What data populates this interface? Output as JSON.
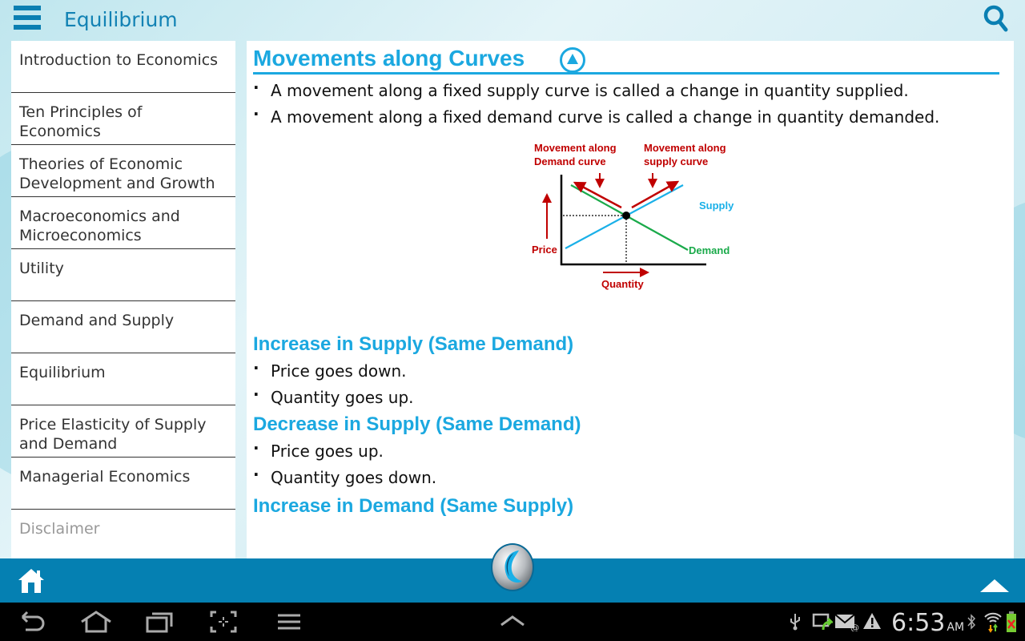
{
  "app": {
    "title": "Equilibrium",
    "menu_icon": "hamburger-menu-icon",
    "search_icon": "search-icon"
  },
  "sidebar": {
    "items": [
      {
        "label": "Introduction to Economics"
      },
      {
        "label": "Ten Principles of Economics"
      },
      {
        "label": "Theories of Economic Development and Growth"
      },
      {
        "label": "Macroeconomics and Microeconomics"
      },
      {
        "label": "Utility"
      },
      {
        "label": "Demand and Supply"
      },
      {
        "label": "Equilibrium"
      },
      {
        "label": "Price Elasticity of Supply and Demand"
      },
      {
        "label": "Managerial Economics"
      },
      {
        "label": "Disclaimer"
      }
    ]
  },
  "content": {
    "section_title": "Movements along Curves",
    "collapse_icon": "collapse-up-icon",
    "intro_bullets": [
      "A movement along a fixed supply curve is called a change in quantity supplied.",
      "A movement along a fixed demand curve is called a change in quantity demanded."
    ],
    "diagram": {
      "label_demand_move_1": "Movement along",
      "label_demand_move_2": "Demand curve",
      "label_supply_move_1": "Movement along",
      "label_supply_move_2": "supply curve",
      "supply_label": "Supply",
      "demand_label": "Demand",
      "price_label": "Price",
      "quantity_label": "Quantity",
      "colors": {
        "arrows": "#c00000",
        "supply": "#1ab0e8",
        "demand": "#1aaa4a",
        "axis": "#000000"
      }
    },
    "subsections": [
      {
        "title": "Increase in Supply (Same Demand)",
        "bullets": [
          "Price goes down.",
          "Quantity goes up."
        ]
      },
      {
        "title": "Decrease in Supply (Same Demand)",
        "bullets": [
          "Price goes up.",
          "Quantity goes down."
        ]
      },
      {
        "title": "Increase in Demand (Same Supply)",
        "bullets": []
      }
    ]
  },
  "bottombar": {
    "home_icon": "home-icon",
    "logo_icon": "app-logo-icon",
    "scroll_top_icon": "scroll-up-icon"
  },
  "system": {
    "time": "6:53",
    "ampm": "AM",
    "nav": [
      "back",
      "home",
      "recent-apps",
      "screenshot",
      "menu",
      "expand"
    ]
  },
  "colors": {
    "accent": "#1ba8e0",
    "appbar": "#0580b2",
    "title": "#1282b4"
  }
}
